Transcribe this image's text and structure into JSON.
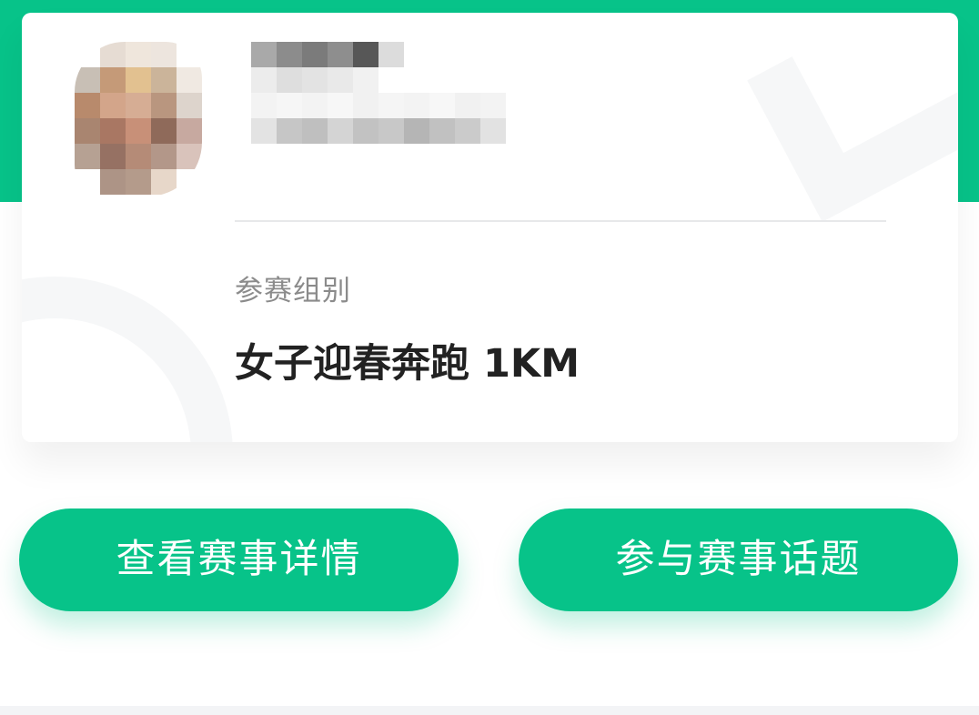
{
  "colors": {
    "brand_green": "#07c389",
    "card_background": "#ffffff",
    "label_gray": "#8b8b8b",
    "value_dark": "#222222"
  },
  "profile": {
    "avatar": "pixelated-user-avatar",
    "name": "",
    "subtitle": ""
  },
  "registration": {
    "group_label": "参赛组别",
    "group_value": "女子迎春奔跑 1KM"
  },
  "actions": {
    "view_details_label": "查看赛事详情",
    "join_topic_label": "参与赛事话题"
  }
}
